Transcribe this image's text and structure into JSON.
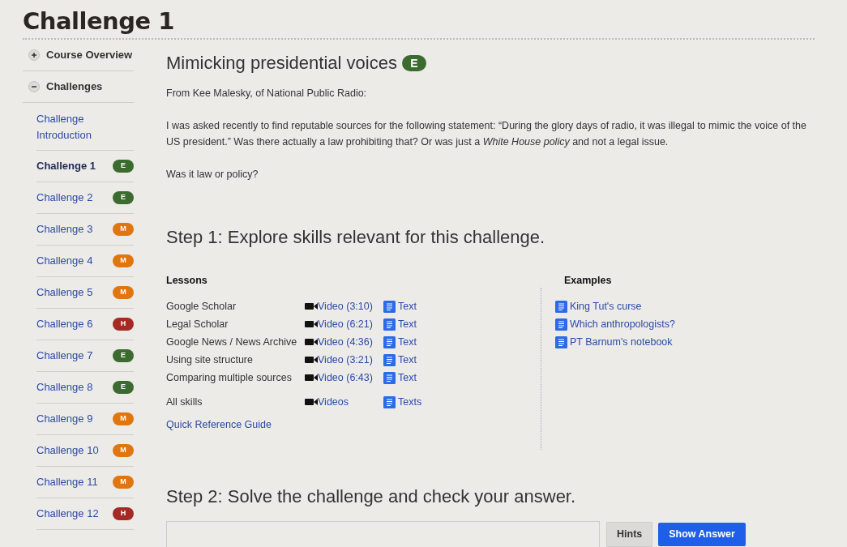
{
  "page_title": "Challenge 1",
  "sidebar": {
    "sections": [
      {
        "label": "Course Overview",
        "expanded": false
      },
      {
        "label": "Challenges",
        "expanded": true,
        "children": [
          {
            "label": "Challenge Introduction",
            "selected": false
          },
          {
            "label": "Challenge 1",
            "selected": true,
            "badge": "E",
            "color": "#3b6b2e"
          },
          {
            "label": "Challenge 2",
            "selected": false,
            "badge": "E",
            "color": "#3b6b2e"
          },
          {
            "label": "Challenge 3",
            "selected": false,
            "badge": "M",
            "color": "#e0760f"
          },
          {
            "label": "Challenge 4",
            "selected": false,
            "badge": "M",
            "color": "#e0760f"
          },
          {
            "label": "Challenge 5",
            "selected": false,
            "badge": "M",
            "color": "#e0760f"
          },
          {
            "label": "Challenge 6",
            "selected": false,
            "badge": "H",
            "color": "#a52a25"
          },
          {
            "label": "Challenge 7",
            "selected": false,
            "badge": "E",
            "color": "#3b6b2e"
          },
          {
            "label": "Challenge 8",
            "selected": false,
            "badge": "E",
            "color": "#3b6b2e"
          },
          {
            "label": "Challenge 9",
            "selected": false,
            "badge": "M",
            "color": "#e0760f"
          },
          {
            "label": "Challenge 10",
            "selected": false,
            "badge": "M",
            "color": "#e0760f"
          },
          {
            "label": "Challenge 11",
            "selected": false,
            "badge": "M",
            "color": "#e0760f"
          },
          {
            "label": "Challenge 12",
            "selected": false,
            "badge": "H",
            "color": "#a52a25"
          }
        ]
      }
    ]
  },
  "challenge": {
    "title": "Mimicking presidential voices",
    "badge": "E",
    "color": "#3b6b2e",
    "paragraphs": [
      "From Kee Malesky, of National Public Radio:",
      "I was asked recently to find reputable sources for the following statement: “During the glory days of radio, it was illegal to mimic the voice of the US president.” Was there actually a law prohibiting that? Or was just a *White House policy* and not a legal issue.",
      "Was it law or policy?"
    ]
  },
  "step1": {
    "heading": "Step 1: Explore skills relevant for this challenge.",
    "lessons_heading": "Lessons",
    "lessons": [
      {
        "name": "Google Scholar",
        "video": "Video (3:10)",
        "text": "Text"
      },
      {
        "name": "Legal Scholar",
        "video": "Video (6:21)",
        "text": "Text"
      },
      {
        "name": "Google News / News Archive",
        "video": "Video (4:36)",
        "text": "Text"
      },
      {
        "name": "Using site structure",
        "video": "Video (3:21)",
        "text": "Text"
      },
      {
        "name": "Comparing multiple sources",
        "video": "Video (6:43)",
        "text": "Text"
      }
    ],
    "all_skills": {
      "name": "All skills",
      "video": "Videos",
      "text": "Texts"
    },
    "quick_reference": "Quick Reference Guide",
    "examples_heading": "Examples",
    "examples": [
      "King Tut's curse",
      "Which anthropologists?",
      "PT Barnum's notebook"
    ]
  },
  "step2": {
    "heading": "Step 2: Solve the challenge and check your answer.",
    "hints_button": "Hints",
    "answer_button": "Show Answer"
  }
}
